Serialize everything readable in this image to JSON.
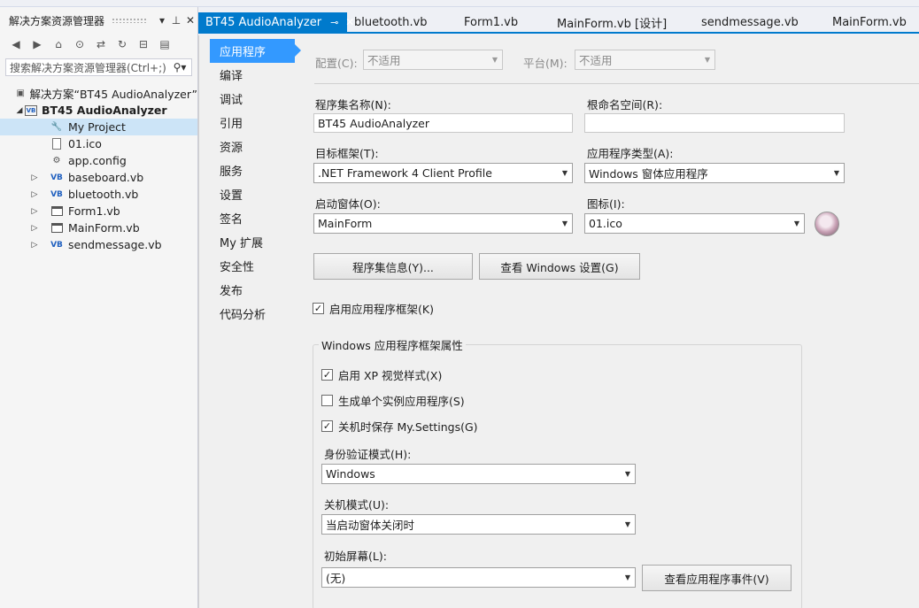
{
  "solution_explorer": {
    "title": "解决方案资源管理器",
    "pin_glyph": "ㅍ",
    "close_glyph": "✕",
    "search_placeholder": "搜索解决方案资源管理器(Ctrl+;)",
    "tree": [
      {
        "label": "解决方案“BT45 AudioAnalyzer”",
        "icon": "solution-icon"
      },
      {
        "label": "BT45 AudioAnalyzer",
        "icon": "vb-project-icon"
      },
      {
        "label": "My Project",
        "icon": "wrench-icon"
      },
      {
        "label": "01.ico",
        "icon": "file-icon"
      },
      {
        "label": "app.config",
        "icon": "config-icon"
      },
      {
        "label": "baseboard.vb",
        "icon": "vb-icon"
      },
      {
        "label": "bluetooth.vb",
        "icon": "vb-icon"
      },
      {
        "label": "Form1.vb",
        "icon": "form-icon"
      },
      {
        "label": "MainForm.vb",
        "icon": "form-icon"
      },
      {
        "label": "sendmessage.vb",
        "icon": "vb-icon"
      }
    ]
  },
  "tabs": [
    {
      "label": "BT45 AudioAnalyzer",
      "active": true
    },
    {
      "label": "bluetooth.vb"
    },
    {
      "label": "Form1.vb"
    },
    {
      "label": "MainForm.vb [设计]"
    },
    {
      "label": "sendmessage.vb"
    },
    {
      "label": "MainForm.vb"
    }
  ],
  "nav": [
    "应用程序",
    "编译",
    "调试",
    "引用",
    "资源",
    "服务",
    "设置",
    "签名",
    "My 扩展",
    "安全性",
    "发布",
    "代码分析"
  ],
  "config": {
    "config_label": "配置(C):",
    "config_value": "不适用",
    "platform_label": "平台(M):",
    "platform_value": "不适用"
  },
  "form": {
    "assembly_name_label": "程序集名称(N):",
    "assembly_name_value": "BT45 AudioAnalyzer",
    "root_namespace_label": "根命名空间(R):",
    "root_namespace_value": "",
    "target_framework_label": "目标框架(T):",
    "target_framework_value": ".NET Framework 4 Client Profile",
    "app_type_label": "应用程序类型(A):",
    "app_type_value": "Windows 窗体应用程序",
    "startup_form_label": "启动窗体(O):",
    "startup_form_value": "MainForm",
    "icon_label": "图标(I):",
    "icon_value": "01.ico",
    "assembly_info_button": "程序集信息(Y)...",
    "view_windows_settings_button": "查看 Windows 设置(G)",
    "enable_framework_label": "启用应用程序框架(K)",
    "enable_framework_checked": true
  },
  "framework_props": {
    "group_title": "Windows 应用程序框架属性",
    "xp_styles_label": "启用 XP 视觉样式(X)",
    "xp_styles_checked": true,
    "single_instance_label": "生成单个实例应用程序(S)",
    "single_instance_checked": false,
    "save_settings_label": "关机时保存 My.Settings(G)",
    "save_settings_checked": true,
    "auth_mode_label": "身份验证模式(H):",
    "auth_mode_value": "Windows",
    "shutdown_mode_label": "关机模式(U):",
    "shutdown_mode_value": "当启动窗体关闭时",
    "splash_label": "初始屏幕(L):",
    "splash_value": "(无)",
    "view_events_button": "查看应用程序事件(V)"
  },
  "colors": {
    "accent": "#007acc",
    "nav_selected": "#3399ff",
    "tree_selected": "#cce4f7"
  }
}
